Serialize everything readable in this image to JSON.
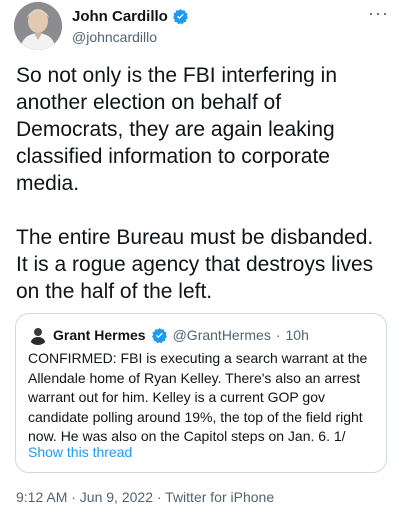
{
  "author": {
    "display_name": "John Cardillo",
    "handle": "@johncardillo",
    "verified_icon": "verified-badge-icon",
    "avatar_icon": "avatar"
  },
  "more_icon": "ellipsis-icon",
  "tweet_text": "So not only is the FBI interfering in\nanother election on behalf of\nDemocrats, they are again leaking\nclassified information to corporate\nmedia.\n\nThe entire Bureau must be disbanded.\nIt is a rogue agency that destroys lives\non the half of the left.",
  "quoted_tweet": {
    "display_name": "Grant Hermes",
    "handle": "@GrantHermes",
    "separator": "·",
    "time": "10h",
    "text": "CONFIRMED: FBI is executing a search warrant at the Allendale home of Ryan Kelley. There's also an arrest warrant out for him. Kelley is a current GOP gov candidate polling around 19%, the top of the field right now. He was also on the Capitol steps on Jan. 6. 1/",
    "show_thread_label": "Show this thread"
  },
  "metadata_line": "9:12 AM · Jun 9, 2022 · Twitter for iPhone",
  "colors": {
    "text": "#0f1419",
    "secondary": "#536471",
    "link": "#1d9bf0",
    "border": "#cfd9de"
  }
}
